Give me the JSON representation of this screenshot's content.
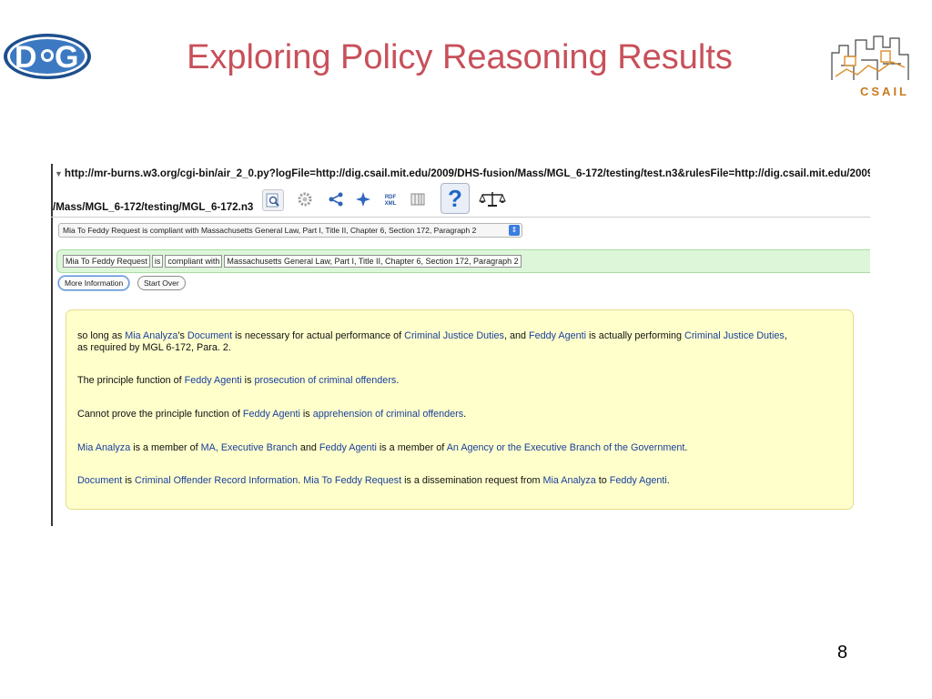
{
  "slide": {
    "title": "Exploring Policy Reasoning Results",
    "page_number": "8",
    "logos": {
      "left": "DiG",
      "right": "CSAIL"
    }
  },
  "browser": {
    "url_line1": "http://mr-burns.w3.org/cgi-bin/air_2_0.py?logFile=http://dig.csail.mit.edu/2009/DHS-fusion/Mass/MGL_6-172/testing/test.n3&rulesFile=http://dig.csail.mit.edu/2009",
    "url_line2": "/Mass/MGL_6-172/testing/MGL_6-172.n3",
    "toolbar_icons": [
      "magnifier-icon",
      "gear-icon",
      "share-graph-icon",
      "sparkle-icon",
      "rdf-xml-icon",
      "table-icon",
      "help-icon",
      "scales-icon"
    ],
    "toolbar_rdf_label_top": "RDF",
    "toolbar_rdf_label_bottom": "XML",
    "help_label": "?"
  },
  "justification": {
    "selected": "Mia To Feddy Request is compliant with Massachusetts General Law, Part I, Title II, Chapter 6, Section 172, Paragraph 2",
    "tokens": [
      "Mia To Feddy Request",
      "is",
      "compliant with",
      "Massachusetts General Law, Part I, Title II, Chapter 6, Section 172, Paragraph 2"
    ],
    "buttons": {
      "more": "More Information",
      "start_over": "Start Over"
    }
  },
  "explanation": {
    "p1": {
      "a": "so long as ",
      "b": "Mia Analyza",
      "c": "'s ",
      "d": "Document",
      "e": " is necessary for actual performance of ",
      "f": "Criminal Justice Duties",
      "g": ", and ",
      "h": "Feddy Agenti",
      "i": " is actually performing ",
      "j": "Criminal Justice Duties",
      "k": ",",
      "l": "as required by MGL 6-172, Para. 2."
    },
    "p2": {
      "a": "The principle function of ",
      "b": "Feddy Agenti",
      "c": " is ",
      "d": "prosecution of criminal offenders",
      "e": "."
    },
    "p3": {
      "a": "Cannot prove the principle function of ",
      "b": "Feddy Agenti",
      "c": " is ",
      "d": "apprehension of criminal offenders",
      "e": "."
    },
    "p4": {
      "a": "Mia Analyza",
      "b": " is a member of ",
      "c": "MA, Executive Branch",
      "d": " and ",
      "e": "Feddy Agenti",
      "f": " is a member of ",
      "g": "An Agency or the Executive Branch of the Government",
      "h": "."
    },
    "p5": {
      "a": "Document",
      "b": " is ",
      "c": "Criminal Offender Record Information",
      "d": ". ",
      "e": "Mia To Feddy Request",
      "f": " is a dissemination request from ",
      "g": "Mia Analyza",
      "h": " to ",
      "i": "Feddy Agenti",
      "j": "."
    }
  }
}
